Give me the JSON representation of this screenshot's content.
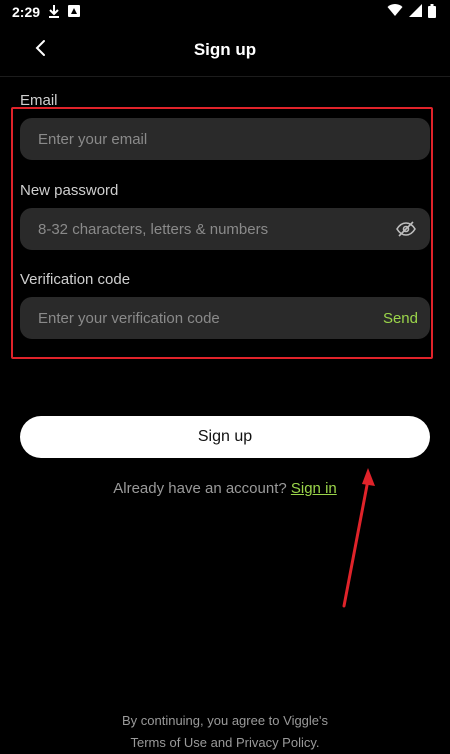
{
  "status_bar": {
    "time": "2:29"
  },
  "header": {
    "title": "Sign up"
  },
  "form": {
    "email": {
      "label": "Email",
      "placeholder": "Enter your email",
      "value": ""
    },
    "password": {
      "label": "New password",
      "placeholder": "8-32 characters, letters & numbers",
      "value": ""
    },
    "verification": {
      "label": "Verification code",
      "placeholder": "Enter your verification code",
      "value": "",
      "send_label": "Send"
    }
  },
  "signup_button": {
    "label": "Sign up"
  },
  "signin_prompt": {
    "text": "Already have an account?",
    "link": "Sign in"
  },
  "footer": {
    "line1": "By continuing, you agree to Viggle's",
    "line2": "Terms of Use and Privacy Policy."
  },
  "colors": {
    "accent": "#9bd54a",
    "annotation": "#e0232a",
    "background": "#000000",
    "field": "#2a2a2a"
  },
  "icons": {
    "back": "chevron-left-icon",
    "password_toggle": "eye-off-icon",
    "download": "download-icon",
    "app": "app-icon",
    "wifi": "wifi-icon",
    "signal": "signal-icon",
    "battery": "battery-icon"
  }
}
